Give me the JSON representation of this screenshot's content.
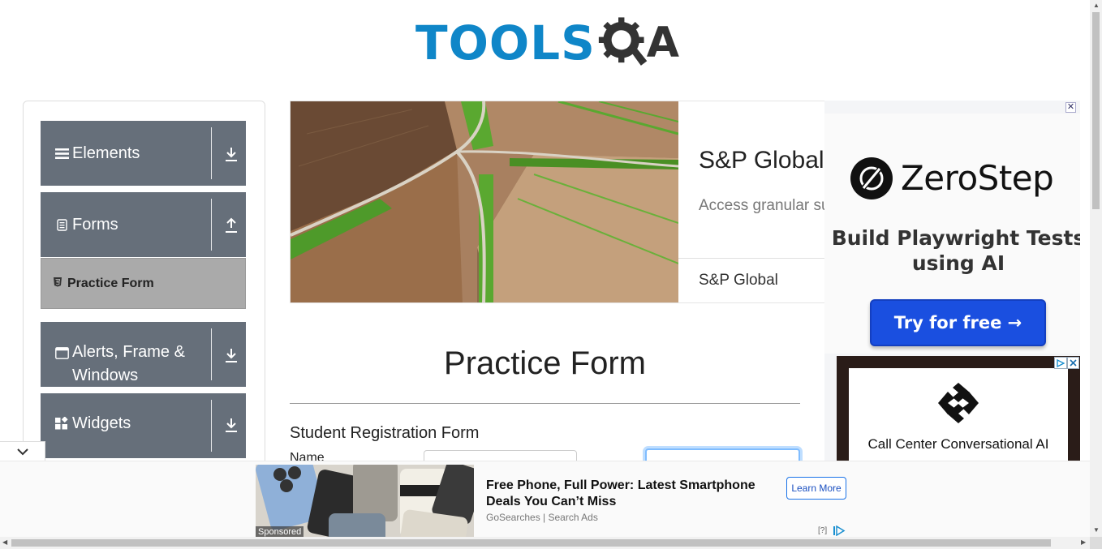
{
  "logo": {
    "text": "TOOLS",
    "suffix": "A"
  },
  "sidebar": {
    "groups": [
      {
        "label": "Elements",
        "icon": "hamburger-icon",
        "arrow": "down"
      },
      {
        "label": "Forms",
        "icon": "document-icon",
        "arrow": "up"
      },
      {
        "label": "Alerts, Frame & Windows",
        "icon": "window-icon",
        "arrow": "down"
      },
      {
        "label": "Widgets",
        "icon": "widgets-icon",
        "arrow": "down"
      }
    ],
    "active_item": {
      "label": "Practice Form",
      "icon": "html5-icon"
    }
  },
  "top_ad": {
    "title": "S&P Global",
    "subtitle": "Access granular sus",
    "brand": "S&P Global"
  },
  "form": {
    "title": "Practice Form",
    "subtitle": "Student Registration Form",
    "name_label": "Name",
    "first_name_value": "",
    "last_name_value": ""
  },
  "right_ad": {
    "close": "✕",
    "brand": "ZeroStep",
    "headline": "Build Playwright Tests using AI",
    "cta": "Try for free →",
    "second_text": "Call Center Conversational AI"
  },
  "bottom_ad": {
    "sponsored": "Sponsored",
    "headline": "Free Phone, Full Power: Latest Smartphone Deals You Can’t Miss",
    "source": "GoSearches | Search Ads",
    "cta": "Learn More",
    "help": "[?]"
  },
  "colors": {
    "brand_blue": "#0f86c8",
    "sidebar_group": "#666f7a",
    "active_item": "#aaaaaa",
    "cta_blue": "#1a4fe0"
  }
}
